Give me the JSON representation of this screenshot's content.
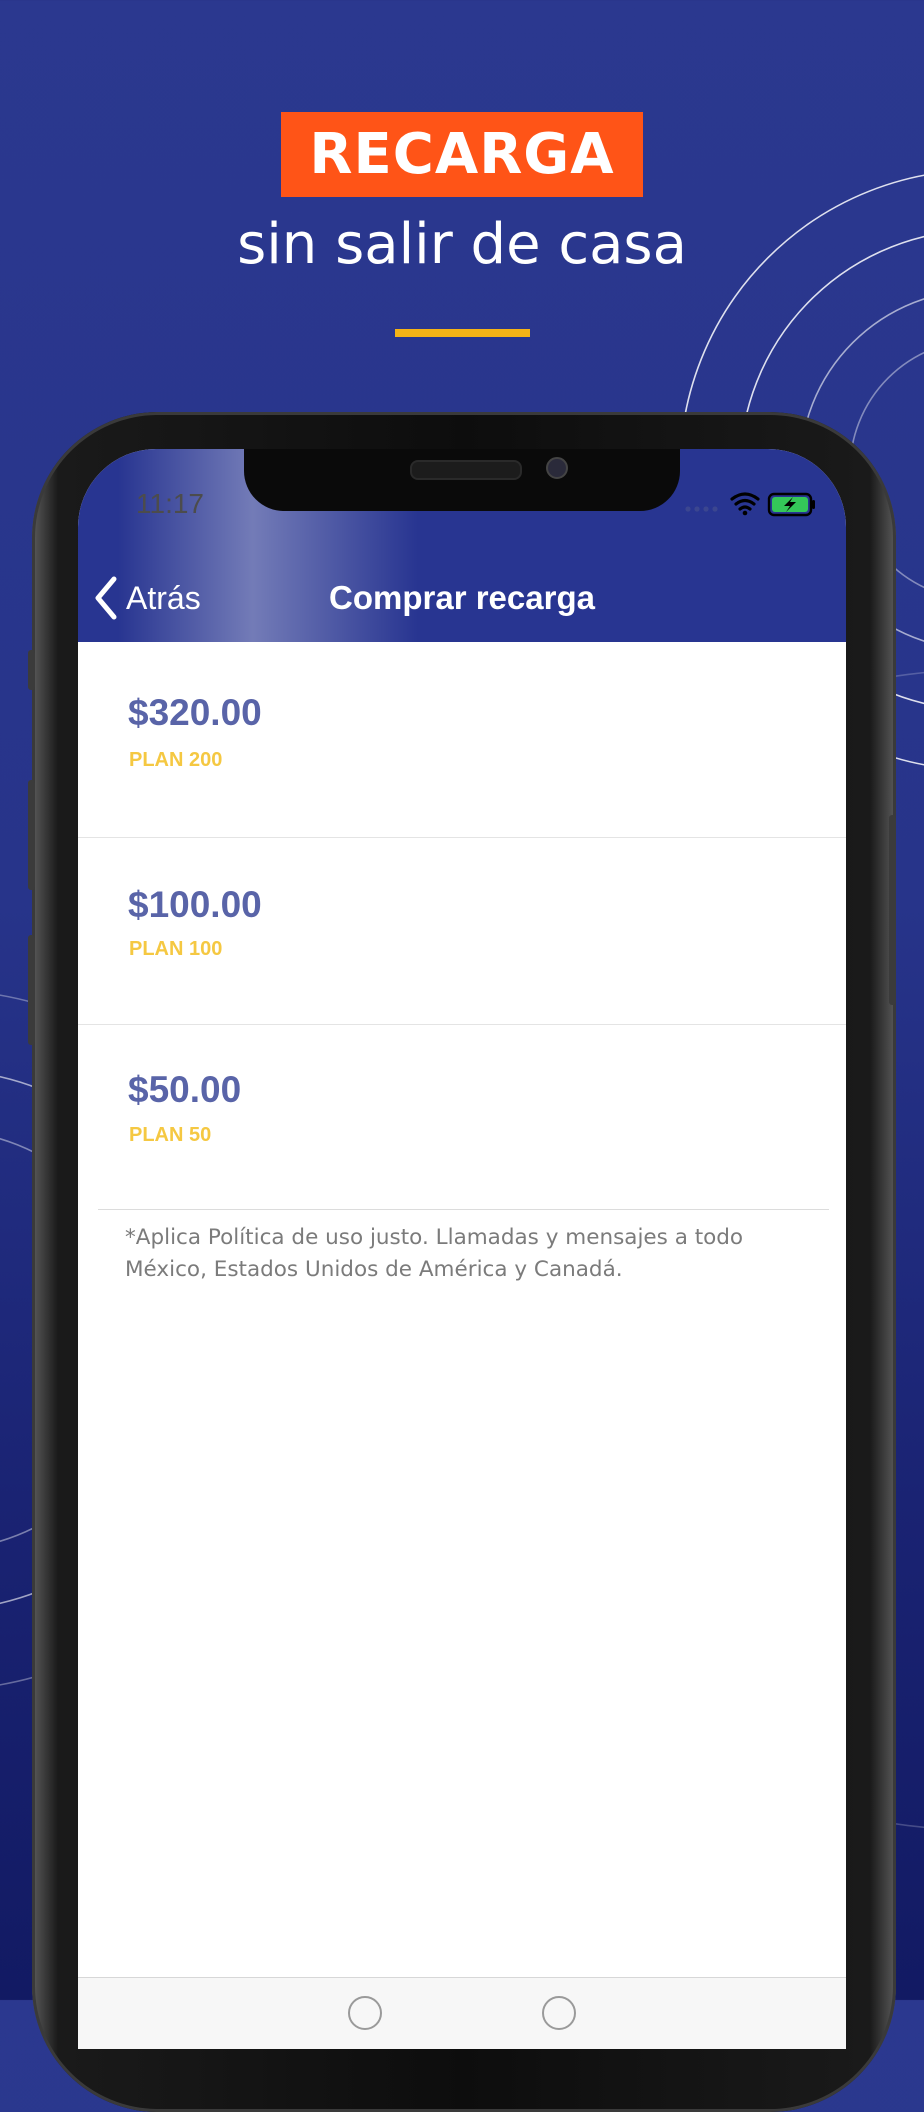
{
  "promo": {
    "badge": "RECARGA",
    "subtitle": "sin salir de casa",
    "badge_color": "#ff5417",
    "accent_color": "#f5b316",
    "background_color": "#27348a"
  },
  "status_bar": {
    "time": "11:17",
    "icons": [
      "signal-dots-icon",
      "wifi-icon",
      "battery-charging-icon"
    ]
  },
  "nav": {
    "back_label": "Atrás",
    "title": "Comprar recarga",
    "back_icon": "chevron-left-icon"
  },
  "plans": [
    {
      "price": "$320.00",
      "name": "PLAN 200"
    },
    {
      "price": "$100.00",
      "name": "PLAN 100"
    },
    {
      "price": "$50.00",
      "name": "PLAN 50"
    }
  ],
  "disclaimer": "*Aplica Política de uso justo. Llamadas y mensajes a todo México,  Estados Unidos de América y Canadá.",
  "colors": {
    "price": "#5964a8",
    "plan_name": "#f5c842",
    "nav_bar": "#283591"
  }
}
